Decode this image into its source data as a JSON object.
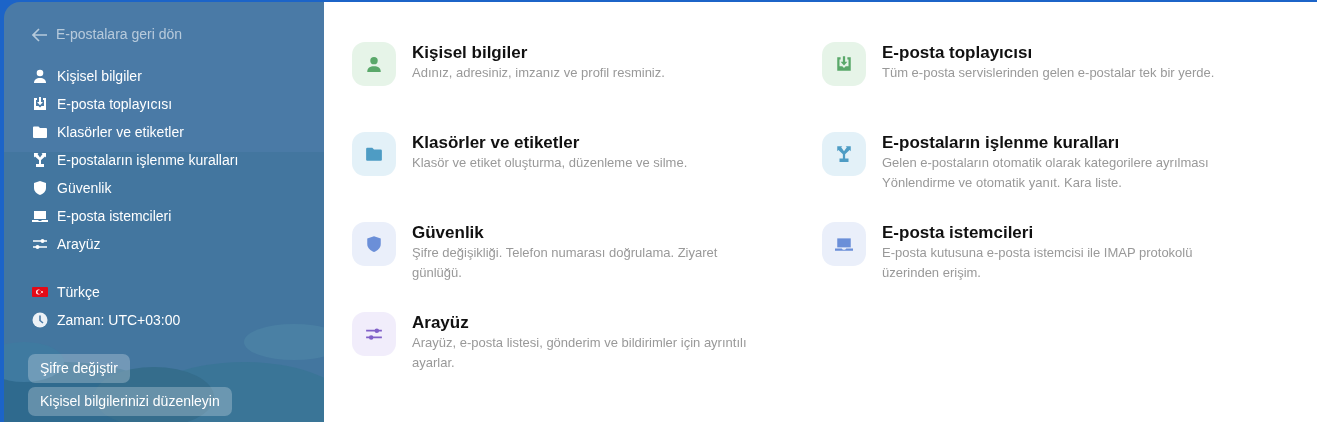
{
  "sidebar": {
    "back_link": "E-postalara geri dön",
    "items": [
      {
        "label": "Kişisel bilgiler"
      },
      {
        "label": "E-posta toplayıcısı"
      },
      {
        "label": "Klasörler ve etiketler"
      },
      {
        "label": "E-postaların işlenme kuralları"
      },
      {
        "label": "Güvenlik"
      },
      {
        "label": "E-posta istemcileri"
      },
      {
        "label": "Arayüz"
      }
    ],
    "language": "Türkçe",
    "time_zone": "Zaman: UTC+03:00",
    "buttons": [
      "Şifre değiştir",
      "Kişisel bilgilerinizi düzenleyin"
    ]
  },
  "cards": [
    {
      "title": "Kişisel bilgiler",
      "description": "Adınız, adresiniz, imzanız ve profil resminiz."
    },
    {
      "title": "E-posta toplayıcısı",
      "description": "Tüm e-posta servislerinden gelen e-postalar tek bir yerde."
    },
    {
      "title": "Klasörler ve etiketler",
      "description": "Klasör ve etiket oluşturma, düzenleme ve silme."
    },
    {
      "title": "E-postaların işlenme kuralları",
      "description": "Gelen e-postaların otomatik olarak kategorilere ayrılması Yönlendirme ve otomatik yanıt. Kara liste."
    },
    {
      "title": "Güvenlik",
      "description": "Şifre değişikliği. Telefon numarası doğrulama. Ziyaret günlüğü."
    },
    {
      "title": "E-posta istemcileri",
      "description": "E-posta kutusuna e-posta istemcisi ile IMAP protokolü üzerinden erişim."
    },
    {
      "title": "Arayüz",
      "description": "Arayüz, e-posta listesi, gönderim ve bildirimler için ayrıntılı ayarlar."
    }
  ]
}
